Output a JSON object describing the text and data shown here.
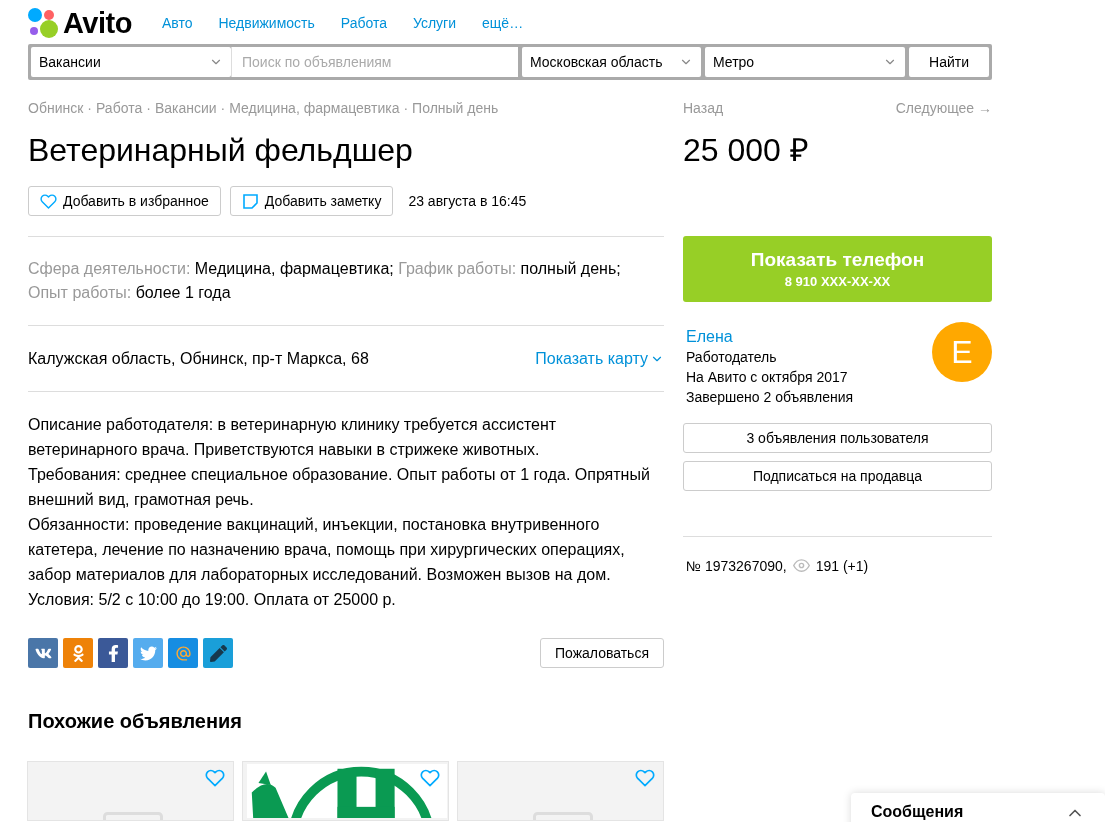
{
  "header": {
    "logo": "Avito",
    "nav": [
      "Авто",
      "Недвижимость",
      "Работа",
      "Услуги",
      "ещё…"
    ]
  },
  "search": {
    "category": "Вакансии",
    "placeholder": "Поиск по объявлениям",
    "region": "Московская область",
    "metro": "Метро",
    "button": "Найти"
  },
  "breadcrumbs": [
    {
      "label": "Обнинск"
    },
    {
      "separator": "·",
      "label": "Работа"
    },
    {
      "separator": "·",
      "label": "Вакансии"
    },
    {
      "separator": "·",
      "label": "Медицина, фармацевтика"
    },
    {
      "separator": "·",
      "label": "Полный день"
    }
  ],
  "title": "Ветеринарный фельдшер",
  "actions": [
    {
      "kind": "favorite",
      "label": "Добавить в избранное"
    },
    {
      "kind": "note",
      "label": "Добавить заметку"
    }
  ],
  "date": "23 августа в 16:45",
  "params": [
    {
      "label": "Сфера деятельности:",
      "value": "Медицина, фармацевтика;"
    },
    {
      "label": "График работы:",
      "value": "полный день;"
    },
    {
      "label": "Опыт работы:",
      "value": "более 1 года"
    }
  ],
  "address": "Калужская область, Обнинск, пр-т Маркса, 68",
  "map_link": "Показать карту",
  "description": [
    "Описание работодателя: в ветеринарную клинику требуется ассистент ветеринарного врача. Приветствуются навыки в стрижеке животных.",
    "Требования: среднее специальное образование. Опыт работы от 1 года. Опрятный внешний вид, грамотная речь.",
    "Обязанности: проведение вакцинаций, инъекции, постановка внутривенного катетера, лечение по назначению врача, помощь при хирургических операциях, забор материалов для лабораторных исследований. Возможен вызов на дом.",
    "Условия: 5/2 с 10:00 до 19:00. Оплата от 25000 р."
  ],
  "share": [
    {
      "kind": "vk",
      "color": "#4a76a8"
    },
    {
      "kind": "ok",
      "color": "#ee8208"
    },
    {
      "kind": "fb",
      "color": "#3b5998"
    },
    {
      "kind": "tw",
      "color": "#55acee"
    },
    {
      "kind": "mail",
      "color": "#168de2"
    },
    {
      "kind": "lj",
      "color": "#1a9fd9"
    }
  ],
  "complain": "Пожаловаться",
  "similar": {
    "title": "Похожие объявления",
    "items": [
      {
        "kind": "placeholder"
      },
      {
        "kind": "picture"
      },
      {
        "kind": "placeholder"
      }
    ]
  },
  "pager": {
    "back": "Назад",
    "next": "Следующее →"
  },
  "price": "25 000 ₽",
  "phone": {
    "label": "Показать телефон",
    "number": "8 910 XXX-XX-XX"
  },
  "seller": {
    "name": "Елена",
    "role": "Работодатель",
    "since": "На Авито с октября 2017",
    "completed": "Завершено 2 объявления",
    "avatar": "Е"
  },
  "seller_buttons": [
    "3 объявления пользователя",
    "Подписаться на продавца"
  ],
  "item_id": "№ 1973267090,",
  "views": "191 (+1)",
  "messages": {
    "title": "Сообщения"
  }
}
